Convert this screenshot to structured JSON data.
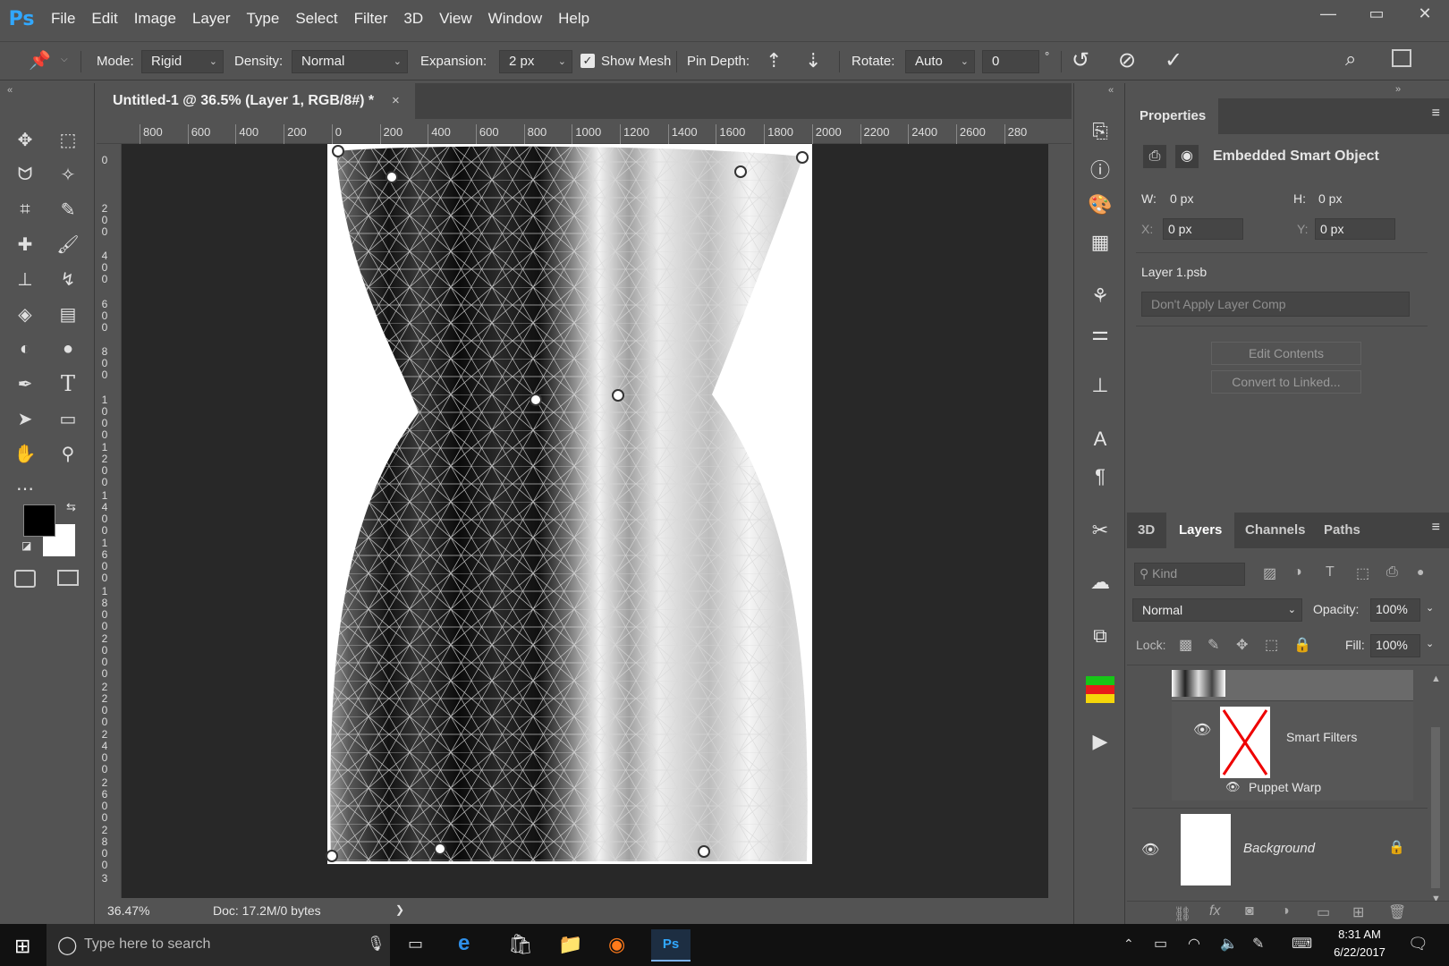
{
  "app": {
    "logo": "Ps",
    "menus": [
      "File",
      "Edit",
      "Image",
      "Layer",
      "Type",
      "Select",
      "Filter",
      "3D",
      "View",
      "Window",
      "Help"
    ]
  },
  "window_controls": {
    "minimize": "—",
    "restore": "▭",
    "close": "✕"
  },
  "options": {
    "mode_label": "Mode:",
    "mode_value": "Rigid",
    "density_label": "Density:",
    "density_value": "Normal",
    "expansion_label": "Expansion:",
    "expansion_value": "2 px",
    "show_mesh_label": "Show Mesh",
    "show_mesh_checked": true,
    "pin_depth_label": "Pin Depth:",
    "rotate_label": "Rotate:",
    "rotate_value": "Auto",
    "rotate_angle": "0",
    "degree": "°"
  },
  "document": {
    "tab_title": "Untitled-1 @ 36.5% (Layer 1, RGB/8#) *",
    "close": "×"
  },
  "ruler": {
    "h_labels": [
      "800",
      "600",
      "400",
      "200",
      "0",
      "200",
      "400",
      "600",
      "800",
      "1000",
      "1200",
      "1400",
      "1600",
      "1800",
      "2000",
      "2200",
      "2400",
      "2600",
      "280"
    ],
    "v_labels": [
      "0",
      "2 0 0",
      "4 0 0",
      "6 0 0",
      "8 0 0",
      "1 0 0 0",
      "1 2 0 0",
      "1 4 0 0",
      "1 6 0 0",
      "1 8 0 0",
      "2 0 0 0",
      "2 2 0 0",
      "2 4 0 0",
      "2 6 0 0",
      "2 8 0 0",
      "3"
    ]
  },
  "status": {
    "zoom": "36.47%",
    "doc": "Doc: 17.2M/0 bytes",
    "arrow": "❯"
  },
  "properties": {
    "tab": "Properties",
    "type": "Embedded Smart Object",
    "w_label": "W:",
    "w_value": "0 px",
    "h_label": "H:",
    "h_value": "0 px",
    "x_label": "X:",
    "x_value": "0 px",
    "y_label": "Y:",
    "y_value": "0 px",
    "file": "Layer 1.psb",
    "layer_comp": "Don't Apply Layer Comp",
    "edit_contents": "Edit Contents",
    "convert": "Convert to Linked..."
  },
  "layers": {
    "tabs": [
      "3D",
      "Layers",
      "Channels",
      "Paths"
    ],
    "active_tab": "Layers",
    "kind": "Kind",
    "blend": "Normal",
    "opacity_label": "Opacity:",
    "opacity": "100%",
    "lock_label": "Lock:",
    "fill_label": "Fill:",
    "fill": "100%",
    "smart_filters": "Smart Filters",
    "puppet_warp": "Puppet Warp",
    "background": "Background"
  },
  "taskbar": {
    "search_placeholder": "Type here to search",
    "time": "8:31 AM",
    "date": "6/22/2017"
  },
  "colors": {
    "accent": "#31a8ff",
    "panel": "#535353",
    "canvas": "#282828"
  }
}
